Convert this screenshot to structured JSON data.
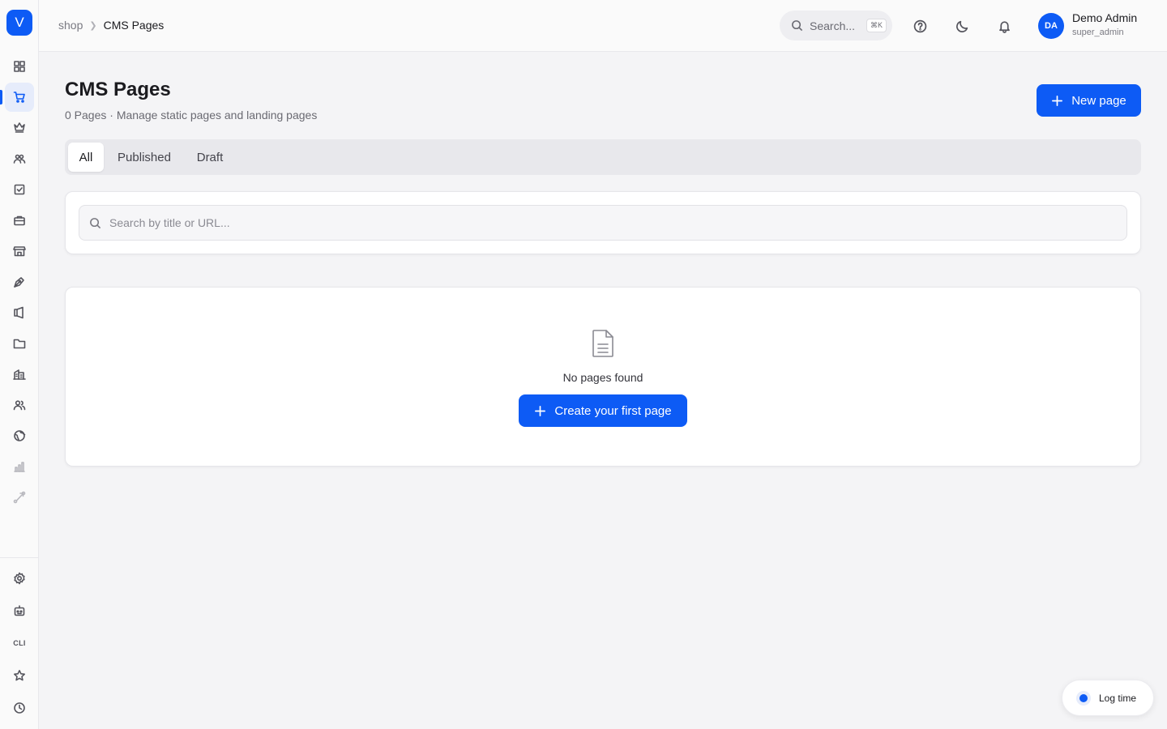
{
  "app": {
    "logo_letter": "V",
    "accent_color": "#0d5bf5"
  },
  "sidebar": {
    "items": [
      {
        "icon": "dashboard-grid-icon",
        "active": false
      },
      {
        "icon": "shopping-cart-icon",
        "active": true
      },
      {
        "icon": "crown-icon",
        "active": false
      },
      {
        "icon": "users-group-icon",
        "active": false
      },
      {
        "icon": "checkbox-task-icon",
        "active": false
      },
      {
        "icon": "briefcase-icon",
        "active": false
      },
      {
        "icon": "storefront-icon",
        "active": false
      },
      {
        "icon": "pen-nib-icon",
        "active": false
      },
      {
        "icon": "megaphone-icon",
        "active": false
      },
      {
        "icon": "folder-icon",
        "active": false
      },
      {
        "icon": "buildings-icon",
        "active": false
      },
      {
        "icon": "contacts-icon",
        "active": false
      },
      {
        "icon": "globe-icon",
        "active": false
      },
      {
        "icon": "bar-chart-icon",
        "active": false,
        "muted": true
      },
      {
        "icon": "route-icon",
        "active": false,
        "muted": true
      }
    ],
    "bottom": [
      {
        "icon": "settings-gear-icon"
      },
      {
        "icon": "robot-icon"
      },
      {
        "icon": "cli-icon",
        "label": "CLI"
      },
      {
        "icon": "star-icon"
      },
      {
        "icon": "clock-icon"
      }
    ]
  },
  "header": {
    "breadcrumb": {
      "parent": "shop",
      "current": "CMS Pages"
    },
    "search": {
      "placeholder": "Search...",
      "shortcut": "⌘K"
    },
    "user": {
      "initials": "DA",
      "name": "Demo Admin",
      "role": "super_admin"
    }
  },
  "page": {
    "title": "CMS Pages",
    "subtitle": "0 Pages · Manage static pages and landing pages",
    "new_button": "New page"
  },
  "tabs": [
    {
      "label": "All",
      "active": true
    },
    {
      "label": "Published",
      "active": false
    },
    {
      "label": "Draft",
      "active": false
    }
  ],
  "filter": {
    "placeholder": "Search by title or URL..."
  },
  "empty_state": {
    "message": "No pages found",
    "button": "Create your first page"
  },
  "log_time": {
    "label": "Log time"
  }
}
